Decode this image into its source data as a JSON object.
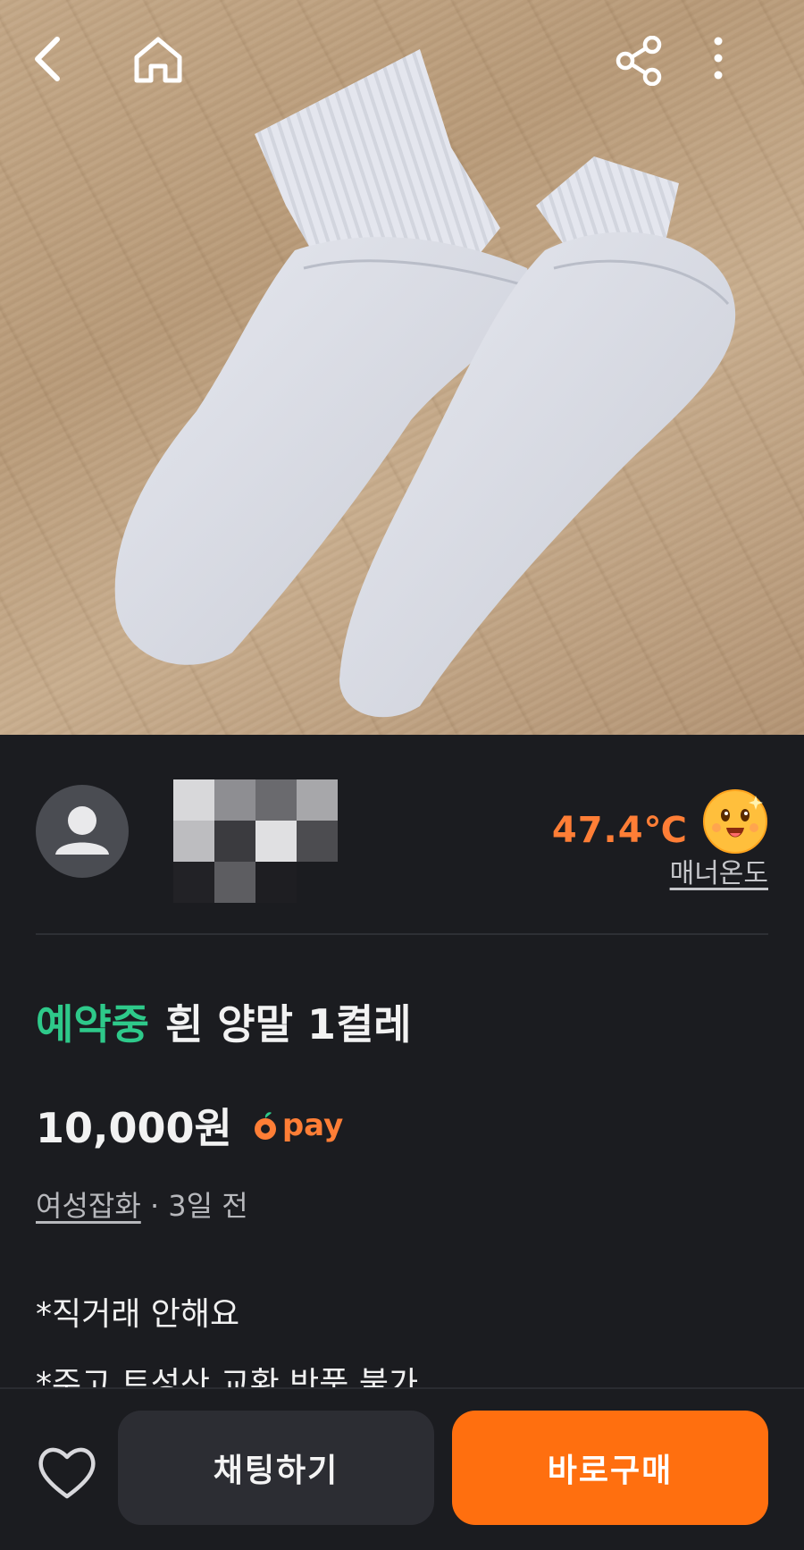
{
  "topbar": {
    "back_icon": "back-arrow-icon",
    "home_icon": "home-icon",
    "share_icon": "share-icon",
    "more_icon": "more-vertical-icon"
  },
  "photo": {
    "subject_icon": "white-socks-photo"
  },
  "seller": {
    "avatar_icon": "default-profile-icon",
    "temperature": "47.4℃",
    "temperature_label": "매너온도",
    "temperature_emoji": "happy-face-icon"
  },
  "product": {
    "status": "예약중",
    "title": "흰 양말 1켤레",
    "price": "10,000원",
    "pay_label": "pay",
    "category": "여성잡화",
    "separator": "·",
    "posted": "3일 전",
    "description": [
      "*직거래 안해요",
      "*주고 트성산 교환 반품 불가"
    ]
  },
  "bottom": {
    "like_icon": "heart-icon",
    "chat_label": "채팅하기",
    "buy_label": "바로구매"
  },
  "colors": {
    "accent": "#ff6f0f",
    "temperature": "#ff7e36",
    "status": "#2ec98a",
    "background": "#1b1c20"
  }
}
